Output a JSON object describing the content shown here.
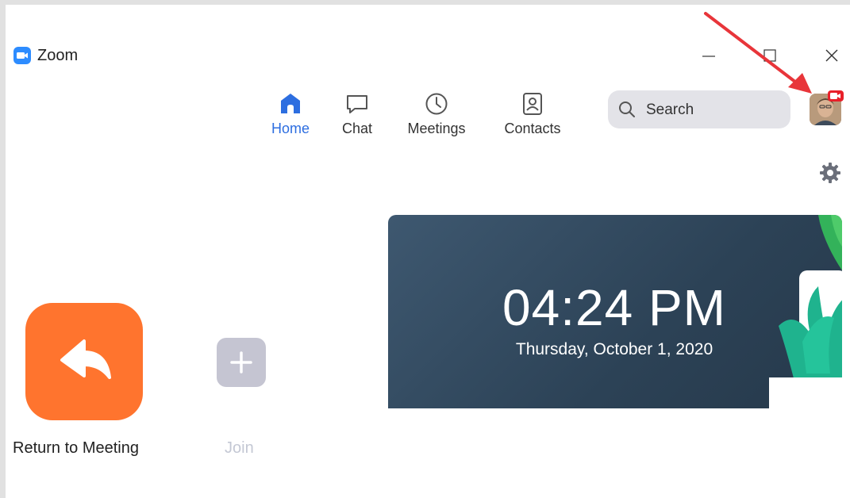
{
  "window": {
    "title": "Zoom"
  },
  "nav": {
    "home": "Home",
    "chat": "Chat",
    "meetings": "Meetings",
    "contacts": "Contacts"
  },
  "search": {
    "placeholder": "Search"
  },
  "clock": {
    "time": "04:24 PM",
    "date": "Thursday, October 1, 2020"
  },
  "actions": {
    "return_label": "Return to Meeting",
    "join_label": "Join"
  },
  "colors": {
    "accent": "#2d8cff",
    "active_nav": "#2d6ee0",
    "return_tile": "#ff742e",
    "join_tile": "#c5c5d2",
    "badge": "#e8202a",
    "annotation_arrow": "#e8353a"
  },
  "icons": {
    "logo": "zoom-camera-icon",
    "home": "home-icon",
    "chat": "chat-bubble-icon",
    "meetings": "clock-icon",
    "contacts": "contact-card-icon",
    "search": "search-icon",
    "settings": "gear-icon",
    "return": "return-arrow-icon",
    "join": "plus-icon"
  }
}
